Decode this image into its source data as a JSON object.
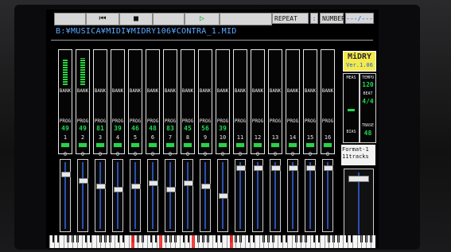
{
  "toolbar": {
    "buttons": [
      {
        "id": "rew",
        "icon": "skip-back-icon",
        "glyph": "⏮"
      },
      {
        "id": "stop",
        "icon": "stop-icon",
        "glyph": "■"
      },
      {
        "id": "play",
        "icon": "play-icon",
        "glyph": "▷"
      }
    ],
    "repeat_label": "REPEAT",
    "repeat_value": ":",
    "number_label": "NUMBER",
    "number_value": "---/---"
  },
  "path": "B:¥MUSICA¥MIDI¥MIDRY106¥CONTRA_1.MID",
  "channels": [
    {
      "num": "1",
      "bank": "BANK",
      "prog_label": "PROG",
      "prog": "49",
      "level": 0.8,
      "fader": 0.15
    },
    {
      "num": "2",
      "bank": "BANK",
      "prog_label": "PROG",
      "prog": "49",
      "level": 0.85,
      "fader": 0.25
    },
    {
      "num": "3",
      "bank": "BANK",
      "prog_label": "PROG",
      "prog": "81",
      "level": 0,
      "fader": 0.35
    },
    {
      "num": "4",
      "bank": "BANK",
      "prog_label": "PROG",
      "prog": "39",
      "level": 0,
      "fader": 0.4
    },
    {
      "num": "5",
      "bank": "BANK",
      "prog_label": "PROG",
      "prog": "46",
      "level": 0,
      "fader": 0.35
    },
    {
      "num": "6",
      "bank": "BANK",
      "prog_label": "PROG",
      "prog": "48",
      "level": 0,
      "fader": 0.3
    },
    {
      "num": "7",
      "bank": "BANK",
      "prog_label": "PROG",
      "prog": "83",
      "level": 0,
      "fader": 0.4
    },
    {
      "num": "8",
      "bank": "BANK",
      "prog_label": "PROG",
      "prog": "45",
      "level": 0,
      "fader": 0.3
    },
    {
      "num": "9",
      "bank": "BANK",
      "prog_label": "PROG",
      "prog": "56",
      "level": 0,
      "fader": 0.35
    },
    {
      "num": "10",
      "bank": "BANK",
      "prog_label": "PROG",
      "prog": "39",
      "level": 0,
      "fader": 0.5
    },
    {
      "num": "11",
      "bank": "BANK",
      "prog_label": "PROG",
      "prog": "",
      "level": 0,
      "fader": 0.05
    },
    {
      "num": "12",
      "bank": "BANK",
      "prog_label": "PROG",
      "prog": "",
      "level": 0,
      "fader": 0.05
    },
    {
      "num": "13",
      "bank": "BANK",
      "prog_label": "PROG",
      "prog": "",
      "level": 0,
      "fader": 0.05
    },
    {
      "num": "14",
      "bank": "BANK",
      "prog_label": "PROG",
      "prog": "",
      "level": 0,
      "fader": 0.05
    },
    {
      "num": "15",
      "bank": "BANK",
      "prog_label": "PROG",
      "prog": "",
      "level": 0,
      "fader": 0.05
    },
    {
      "num": "16",
      "bank": "BANK",
      "prog_label": "PROG",
      "prog": "",
      "level": 0,
      "fader": 0.05
    }
  ],
  "zero_label": "0",
  "logo": {
    "title": "MiDRY",
    "version": "Ver.1.06"
  },
  "side": {
    "meas_label": "MEAS",
    "tempo_label": "TEMPO",
    "tempo_value": "120",
    "beat_label": "BEAT",
    "beat_value": "4/4",
    "bias_label": "BIAS",
    "tbase_label": "TBASE",
    "tbase_value": "48"
  },
  "format": {
    "line1": "Format-1",
    "line2": "11tracks"
  },
  "colors": {
    "accent": "#27d65a",
    "path": "#64a9ff",
    "logo": "#f3e85a"
  }
}
